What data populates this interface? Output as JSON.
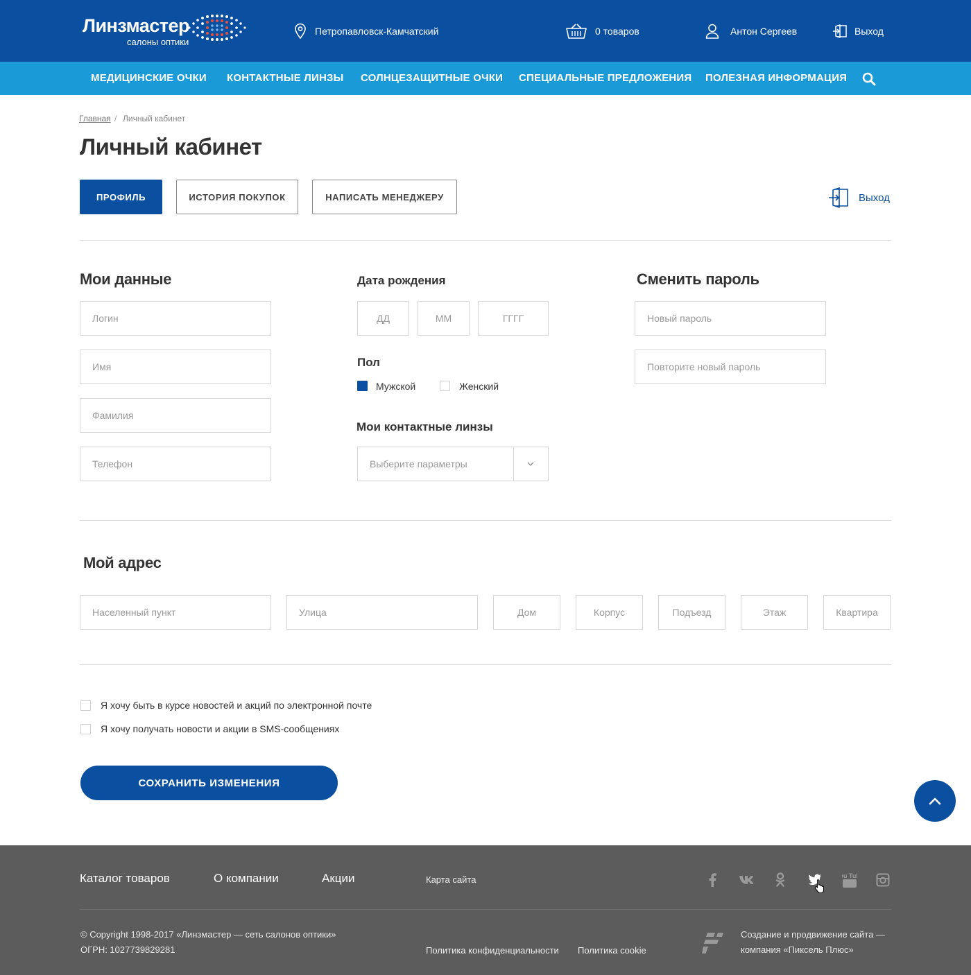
{
  "header": {
    "logo_name": "Линзмастер",
    "logo_sub": "салоны оптики",
    "city": "Петропавловск-Камчатский",
    "cart": "0 товаров",
    "user": "Антон Сергеев",
    "logout": "Выход"
  },
  "nav": {
    "items": [
      "МЕДИЦИНСКИЕ ОЧКИ",
      "КОНТАКТНЫЕ ЛИНЗЫ",
      "СОЛНЦЕЗАЩИТНЫЕ ОЧКИ",
      "СПЕЦИАЛЬНЫЕ ПРЕДЛОЖЕНИЯ",
      "ПОЛЕЗНАЯ ИНФОРМАЦИЯ"
    ]
  },
  "breadcrumb": {
    "home": "Главная",
    "separator": "/",
    "current": "Личный кабинет"
  },
  "page": {
    "title": "Личный кабинет",
    "tabs": [
      "ПРОФИЛЬ",
      "ИСТОРИЯ ПОКУПОК",
      "НАПИСАТЬ МЕНЕДЖЕРУ"
    ],
    "logout": "Выход"
  },
  "my_data": {
    "title": "Мои данные",
    "login_placeholder": "Логин",
    "name_placeholder": "Имя",
    "surname_placeholder": "Фамилия",
    "phone_placeholder": "Телефон"
  },
  "birth": {
    "title": "Дата рождения",
    "day_placeholder": "ДД",
    "month_placeholder": "ММ",
    "year_placeholder": "ГГГГ"
  },
  "gender": {
    "title": "Пол",
    "male": "Мужской",
    "female": "Женский"
  },
  "lenses": {
    "title": "Мои контактные линзы",
    "select_placeholder": "Выберите параметры"
  },
  "password": {
    "title": "Сменить пароль",
    "new_placeholder": "Новый пароль",
    "repeat_placeholder": "Повторите новый пароль"
  },
  "address": {
    "title": "Мой адрес",
    "city_placeholder": "Населенный пункт",
    "street_placeholder": "Улица",
    "house_placeholder": "Дом",
    "building_placeholder": "Корпус",
    "entrance_placeholder": "Подъезд",
    "floor_placeholder": "Этаж",
    "apartment_placeholder": "Квартира"
  },
  "subscriptions": {
    "email": "Я хочу быть в курсе новостей и акций по электронной почте",
    "sms": "Я хочу получать новости и акции в SMS-сообщениях"
  },
  "actions": {
    "save": "СОХРАНИТЬ ИЗМЕНЕНИЯ"
  },
  "footer": {
    "catalog": "Каталог товаров",
    "about": "О компании",
    "promo": "Акции",
    "sitemap": "Карта сайта",
    "copyright": "© Copyright 1998-2017 «Линзмастер — сеть салонов оптики»",
    "ogrn": "ОГРН: 1027739829281",
    "privacy": "Политика конфиденциальности",
    "cookie": "Политика cookie",
    "dev_line1": "Создание и продвижение сайта —",
    "dev_line2": "компания «Пиксель Плюс»",
    "social_youtube_text": "You Tube"
  },
  "colors": {
    "primary": "#0a4fa0",
    "nav": "#1b9ad8",
    "footer": "#5c5c5c"
  }
}
